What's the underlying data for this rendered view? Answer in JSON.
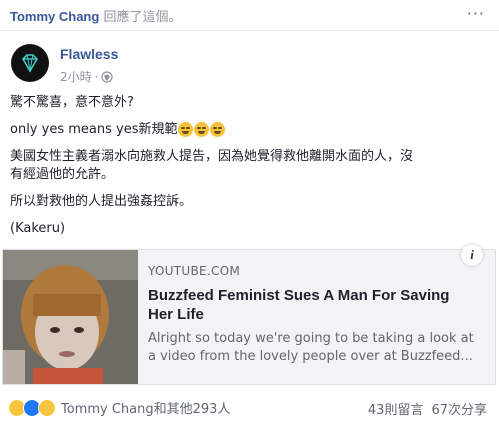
{
  "shared_header": {
    "sharer_name": "Tommy Chang",
    "action_text": "回應了這個。",
    "more_label": "···"
  },
  "post": {
    "page_name": "Flawless",
    "time": "2小時",
    "separator": "·",
    "privacy_icon": "globe-icon",
    "lines": [
      "驚不驚喜，意不意外?",
      "only yes means yes新規範",
      "美國女性主義者溺水向施救人提告，因為她覺得救他離開水面的人，沒",
      "有經過他的允許。",
      "所以對救他的人提出強姦控訴。",
      "(Kakeru)"
    ]
  },
  "link_card": {
    "domain": "YOUTUBE.COM",
    "title": "Buzzfeed Feminist Sues A Man For Saving Her Life",
    "description": "Alright so today we're going to be taking a look at a video from the lovely people over at Buzzfeed...",
    "info_label": "i"
  },
  "footer": {
    "reaction_icons": [
      "haha-icon",
      "like-icon",
      "wow-icon"
    ],
    "reactors_text": "Tommy Chang和其他293人",
    "comments_text": "43則留言",
    "shares_text": "67次分享"
  }
}
